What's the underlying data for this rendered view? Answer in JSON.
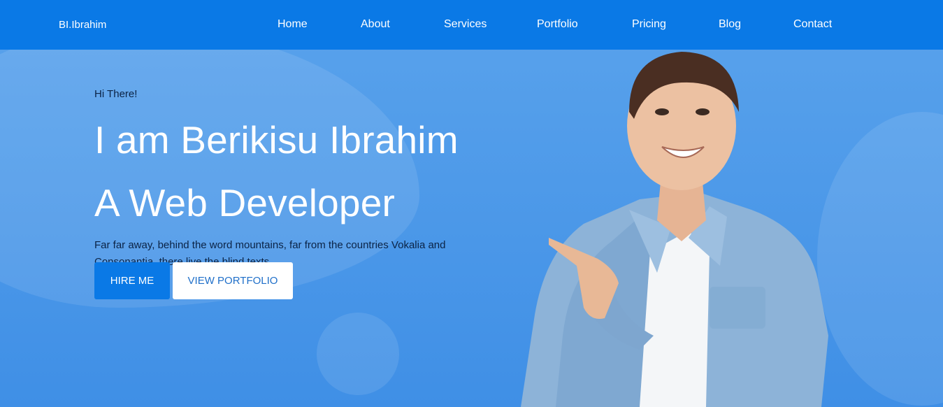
{
  "brand": "BI.Ibrahim",
  "nav": {
    "items": [
      "Home",
      "About",
      "Services",
      "Portfolio",
      "Pricing",
      "Blog",
      "Contact"
    ]
  },
  "hero": {
    "greeting": "Hi There!",
    "line1": "I am Berikisu Ibrahim",
    "line2": "A Web Developer",
    "description": "Far far away, behind the word mountains, far from the countries Vokalia and Consonantia, there live the blind texts."
  },
  "buttons": {
    "hire": "HIRE ME",
    "portfolio": "VIEW PORTFOLIO"
  },
  "colors": {
    "nav_bg": "#0a79e6",
    "hero_bg": "#4d9ae8",
    "primary_button": "#0a79e6",
    "dark_text": "#0b2345"
  }
}
